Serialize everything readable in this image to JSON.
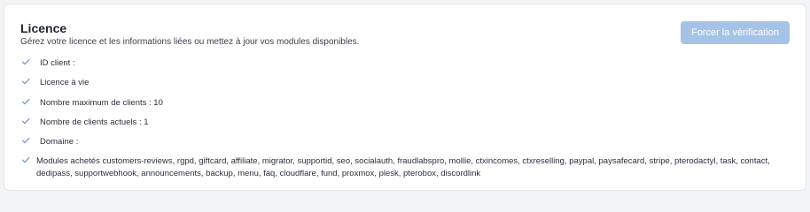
{
  "license": {
    "title": "Licence",
    "subtitle": "Gérez votre licence et les informations liées ou mettez à jour vos modules disponibles.",
    "force_button_label": "Forcer la vérification",
    "items": [
      {
        "label": "ID client :"
      },
      {
        "label": "Licence à vie"
      },
      {
        "label": "Nombre maximum de clients : 10"
      },
      {
        "label": "Nombre de clients actuels : 1"
      },
      {
        "label": "Domaine :"
      },
      {
        "label": "Modules achetés customers-reviews, rgpd, giftcard, affiliate, migrator, supportid, seo, socialauth, fraudlabspro, mollie, ctxincomes, ctxreselling, paypal, paysafecard, stripe, pterodactyl, task, contact, dedipass, supportwebhook, announcements, backup, menu, faq, cloudflare, fund, proxmox, plesk, pterobox, discordlink"
      }
    ]
  },
  "icons": {
    "check": "check-icon"
  },
  "colors": {
    "button_bg": "#a4c3e6",
    "check": "#7a9cc8",
    "card_border": "#e2e5ea"
  }
}
